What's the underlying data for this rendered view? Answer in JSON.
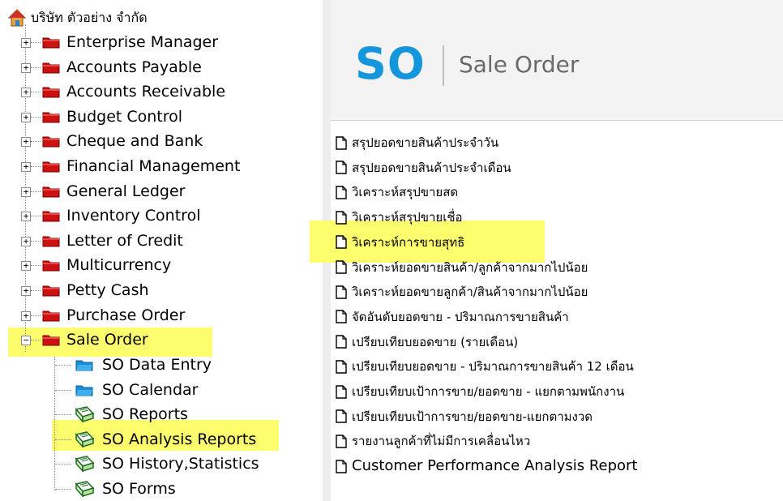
{
  "tree": {
    "root_label": "บริษัท ตัวอย่าง จำกัด",
    "modules": [
      {
        "label": "Enterprise Manager",
        "expander": "+"
      },
      {
        "label": "Accounts Payable",
        "expander": "+"
      },
      {
        "label": "Accounts Receivable",
        "expander": "+"
      },
      {
        "label": "Budget Control",
        "expander": "+"
      },
      {
        "label": "Cheque and Bank",
        "expander": "+"
      },
      {
        "label": "Financial Management",
        "expander": "+"
      },
      {
        "label": "General Ledger",
        "expander": "+"
      },
      {
        "label": "Inventory Control",
        "expander": "+"
      },
      {
        "label": "Letter of Credit",
        "expander": "+"
      },
      {
        "label": "Multicurrency",
        "expander": "+"
      },
      {
        "label": "Petty Cash",
        "expander": "+"
      },
      {
        "label": "Purchase Order",
        "expander": "+"
      },
      {
        "label": "Sale Order",
        "expander": "−",
        "highlighted": true
      }
    ],
    "sale_order_children": [
      {
        "label": "SO Data Entry",
        "icon": "blue-folder-icon"
      },
      {
        "label": "SO Calendar",
        "icon": "blue-folder-icon"
      },
      {
        "label": "SO Reports",
        "icon": "report-book-icon"
      },
      {
        "label": "SO Analysis Reports",
        "icon": "report-book-icon",
        "highlighted": true
      },
      {
        "label": "SO History,Statistics",
        "icon": "report-book-icon"
      },
      {
        "label": "SO Forms",
        "icon": "report-book-icon"
      }
    ]
  },
  "header": {
    "module_code": "SO",
    "module_name": "Sale Order"
  },
  "reports": [
    "สรุปยอดขายสินค้าประจำวัน",
    "สรุปยอดขายสินค้าประจำเดือน",
    "วิเคราะห์สรุปขายสด",
    "วิเคราะห์สรุปขายเชื่อ",
    "วิเคราะห์การขายสุทธิ",
    "วิเคราะห์ยอดขายสินค้า/ลูกค้าจากมากไปน้อย",
    "วิเคราะห์ยอดขายลูกค้า/สินค้าจากมากไปน้อย",
    "จัดอันดับยอดขาย - ปริมาณการขายสินค้า",
    "เปรียบเทียบยอดขาย (รายเดือน)",
    "เปรียบเทียบยอดขาย - ปริมาณการขายสินค้า  12 เดือน",
    "เปรียบเทียบเป้าการขาย/ยอดขาย - แยกตามพนักงาน",
    "เปรียบเทียบเป้าการขาย/ยอดขาย-แยกตามงวด",
    "รายงานลูกค้าที่ไม่มีการเคลื่อนไหว",
    "Customer Performance Analysis Report"
  ],
  "highlighted_report": "วิเคราะห์การขายสุทธิ",
  "colors": {
    "highlight": "#fdfd6e",
    "module_code": "#1496dc",
    "folder_red": "#cc1111",
    "folder_blue": "#1a8fd8"
  }
}
